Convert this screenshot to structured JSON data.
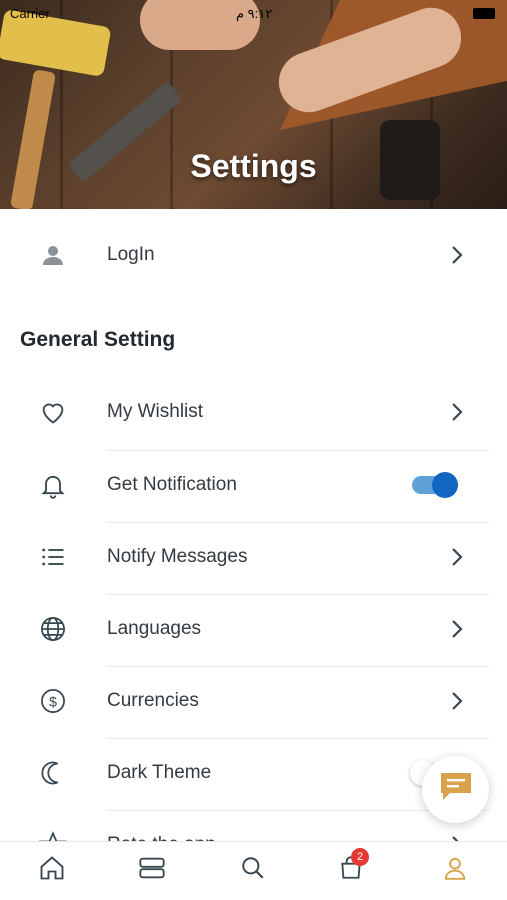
{
  "status_bar": {
    "carrier": "Carrier",
    "time": "٩:١٢ م"
  },
  "header": {
    "title": "Settings"
  },
  "account": {
    "login_label": "LogIn"
  },
  "general": {
    "section_title": "General Setting",
    "items": [
      {
        "label": "My Wishlist",
        "icon": "heart-icon",
        "control": "chevron"
      },
      {
        "label": "Get Notification",
        "icon": "bell-icon",
        "control": "toggle",
        "enabled": true
      },
      {
        "label": "Notify Messages",
        "icon": "list-icon",
        "control": "chevron"
      },
      {
        "label": "Languages",
        "icon": "globe-icon",
        "control": "chevron"
      },
      {
        "label": "Currencies",
        "icon": "dollar-icon",
        "control": "chevron"
      },
      {
        "label": "Dark Theme",
        "icon": "moon-icon",
        "control": "toggle",
        "enabled": false
      },
      {
        "label": "Rate the app",
        "icon": "star-icon",
        "control": "chevron"
      }
    ]
  },
  "bottom_nav": {
    "items": [
      "home-icon",
      "categories-icon",
      "search-icon",
      "cart-icon",
      "profile-icon"
    ],
    "cart_badge": "2",
    "active": "profile-icon"
  },
  "colors": {
    "accent": "#1166c1",
    "active_tab": "#d8a24a",
    "icon": "#37474f"
  }
}
